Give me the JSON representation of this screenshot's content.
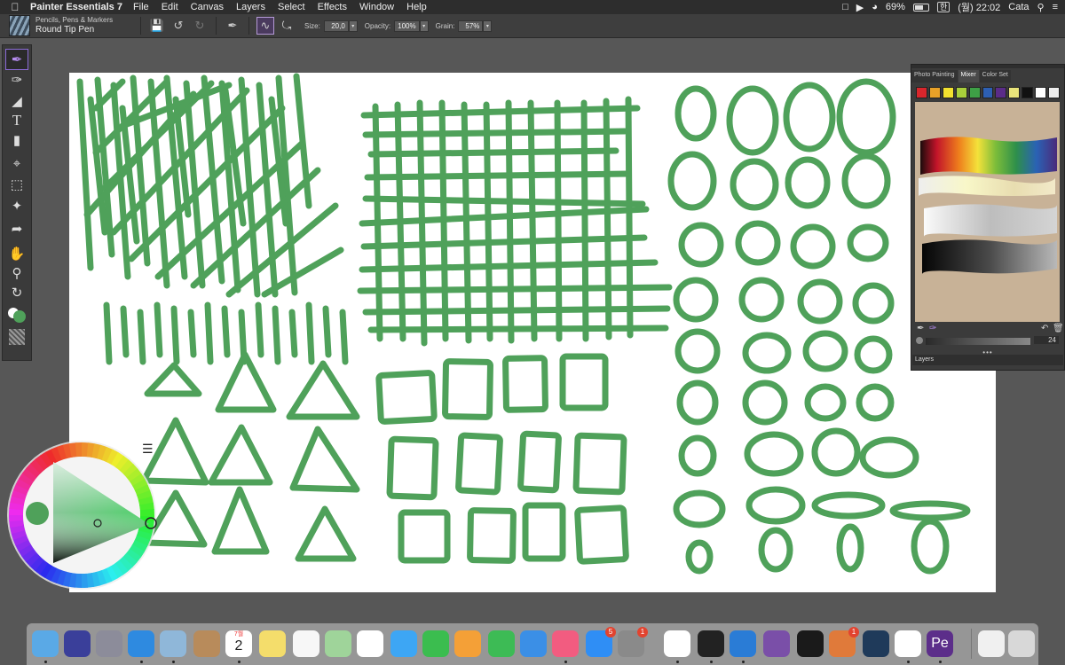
{
  "menubar": {
    "apple": "",
    "app_name": "Painter Essentials 7",
    "menus": [
      "File",
      "Edit",
      "Canvas",
      "Layers",
      "Select",
      "Effects",
      "Window",
      "Help"
    ],
    "battery_percent": "69%",
    "input_badge": "한",
    "clock": "(월) 22:02",
    "user": "Cata"
  },
  "propbar": {
    "brush_category": "Pencils, Pens & Markers",
    "brush_name": "Round Tip Pen",
    "size_label": "Size:",
    "size_value": "20,0",
    "opacity_label": "Opacity:",
    "opacity_value": "100%",
    "grain_label": "Grain:",
    "grain_value": "57%"
  },
  "mixer": {
    "tabs": [
      "Photo Painting",
      "Mixer",
      "Color Set"
    ],
    "active_tab": "Mixer",
    "swatches": [
      "#d9262c",
      "#e8a128",
      "#f3e12f",
      "#a9cf3b",
      "#3ea046",
      "#2d5fb3",
      "#5a2c88",
      "#e9e47b",
      "#111111",
      "#ffffff",
      "#eeeeee"
    ],
    "brush_size_value": "24",
    "layers_label": "Layers"
  },
  "colors": {
    "stroke": "#4fa15a",
    "current_color": "#4fa15a",
    "canvas": "#ffffff",
    "ui_dark": "#3b3b3b"
  },
  "dock": {
    "icons": [
      "finder",
      "siri",
      "launchpad",
      "safari",
      "preview",
      "contacts",
      "calendar",
      "notes",
      "reminders",
      "maps",
      "photos",
      "messages",
      "facetime",
      "pages",
      "numbers",
      "keynote",
      "music",
      "app-store",
      "system-preferences",
      "chrome",
      "terminal",
      "vscode",
      "emacs",
      "piano",
      "bug-app",
      "steam",
      "w-app",
      "painter",
      "documents",
      "trash"
    ],
    "calendar_month": "7월",
    "calendar_day": "2",
    "app_store_badge": "5",
    "system_preferences_badge": "1",
    "bug_app_badge": "1"
  }
}
